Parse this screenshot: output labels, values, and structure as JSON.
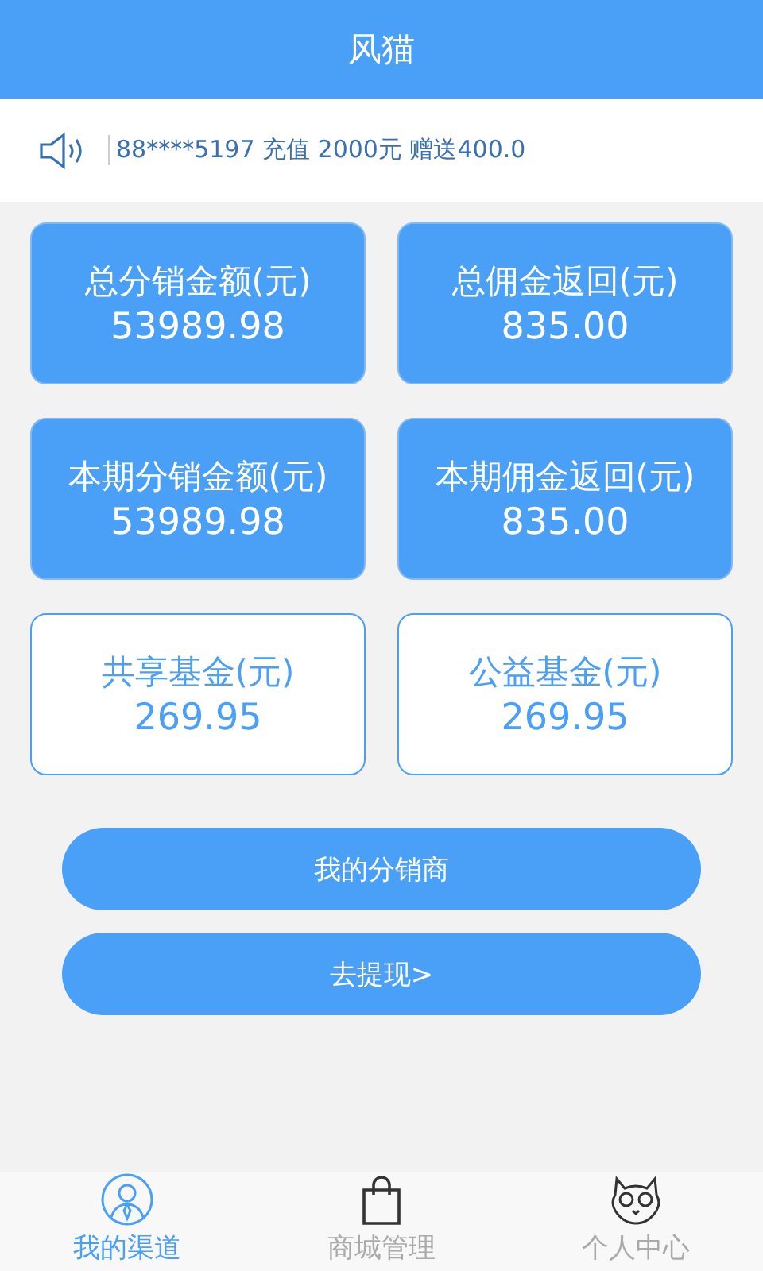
{
  "header": {
    "title": "风猫"
  },
  "notice": {
    "text": "88****5197 充值 2000元 赠送400.0"
  },
  "cards": [
    {
      "kind": "filled",
      "label": "总分销金额(元)",
      "value": "53989.98"
    },
    {
      "kind": "filled",
      "label": "总佣金返回(元)",
      "value": "835.00"
    },
    {
      "kind": "filled",
      "label": "本期分销金额(元)",
      "value": "53989.98"
    },
    {
      "kind": "filled",
      "label": "本期佣金返回(元)",
      "value": "835.00"
    },
    {
      "kind": "outline",
      "label": "共享基金(元)",
      "value": "269.95"
    },
    {
      "kind": "outline",
      "label": "公益基金(元)",
      "value": "269.95"
    }
  ],
  "buttons": [
    "我的分销商",
    "去提现>"
  ],
  "tabs": [
    {
      "kind": "person",
      "label": "我的渠道",
      "selected": true
    },
    {
      "kind": "bag",
      "label": "商城管理",
      "selected": false
    },
    {
      "kind": "cat",
      "label": "个人中心",
      "selected": false
    }
  ]
}
